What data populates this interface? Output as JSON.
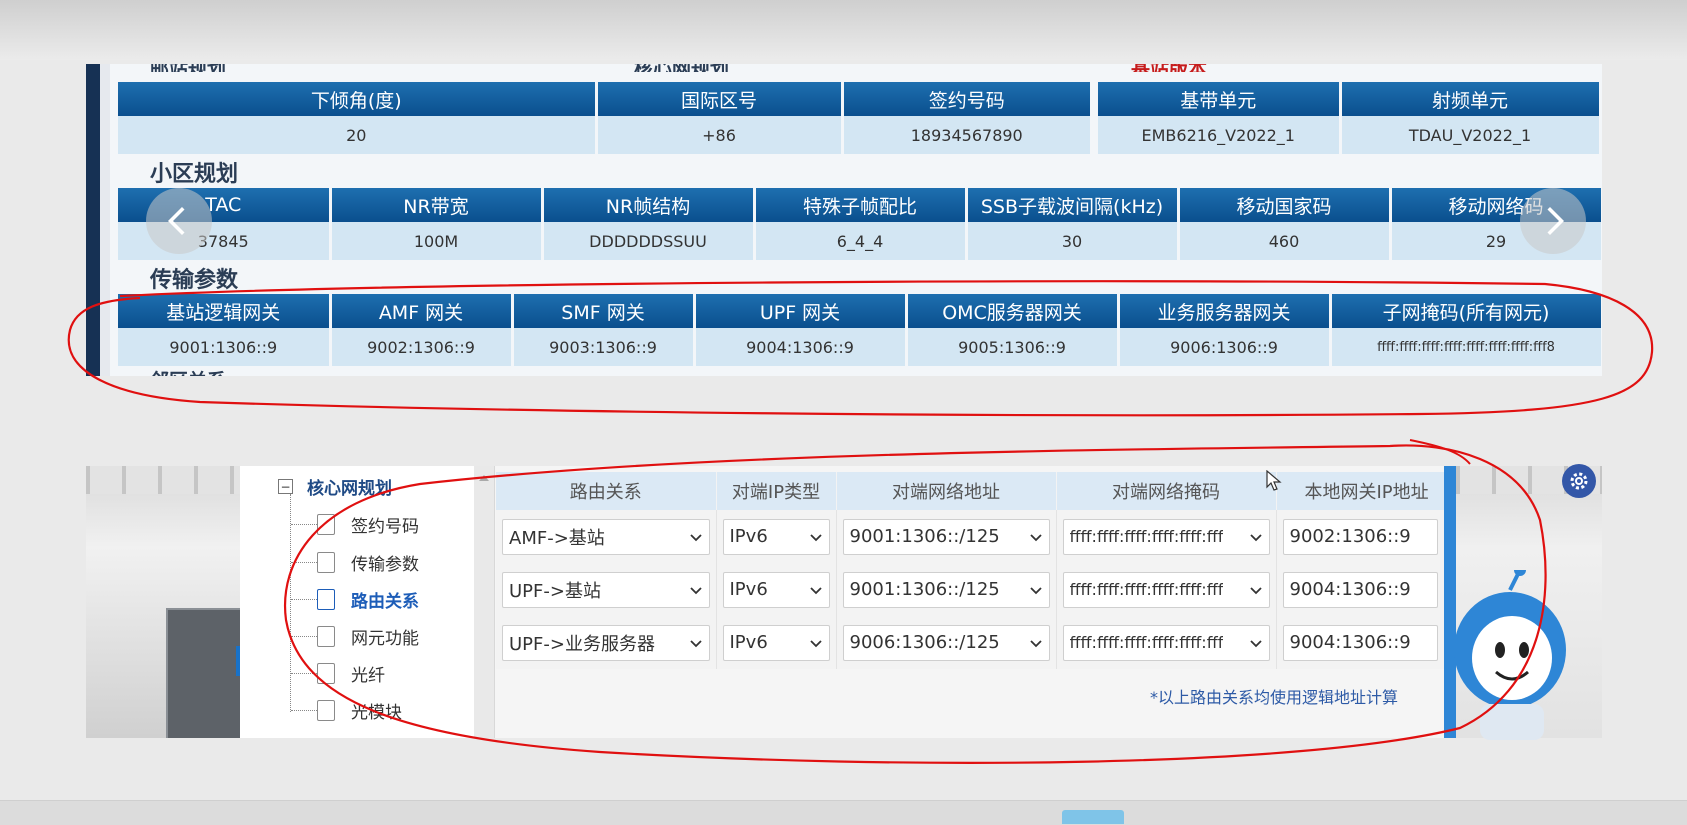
{
  "top": {
    "cut_titles": [
      "邮站规划",
      "核心网规划",
      "基站版本"
    ],
    "row1": {
      "headers": [
        "下倾角(度)",
        "国际区号",
        "签约号码",
        "基带单元",
        "射频单元"
      ],
      "values": [
        "20",
        "+86",
        "18934567890",
        "EMB6216_V2022_1",
        "TDAU_V2022_1"
      ]
    },
    "cell_title": "小区规划",
    "row2": {
      "headers": [
        "TAC",
        "NR带宽",
        "NR帧结构",
        "特殊子帧配比",
        "SSB子载波间隔(kHz)",
        "移动国家码",
        "移动网络码"
      ],
      "values": [
        "37845",
        "100M",
        "DDDDDDSSUU",
        "6_4_4",
        "30",
        "460",
        "29"
      ]
    },
    "trans_title": "传输参数",
    "row3": {
      "headers": [
        "基站逻辑网关",
        "AMF 网关",
        "SMF 网关",
        "UPF 网关",
        "OMC服务器网关",
        "业务服务器网关",
        "子网掩码(所有网元)"
      ],
      "values": [
        "9001:1306::9",
        "9002:1306::9",
        "9003:1306::9",
        "9004:1306::9",
        "9005:1306::9",
        "9006:1306::9",
        "ffff:ffff:ffff:ffff:ffff:ffff:ffff:fff8"
      ]
    },
    "cut_bottom_title": "邻区关系"
  },
  "tree": {
    "root_label": "核心网规划",
    "items": [
      {
        "label": "签约号码",
        "active": false
      },
      {
        "label": "传输参数",
        "active": false
      },
      {
        "label": "路由关系",
        "active": true
      },
      {
        "label": "网元功能",
        "active": false
      },
      {
        "label": "光纤",
        "active": false
      },
      {
        "label": "光模块",
        "active": false
      }
    ]
  },
  "route_table": {
    "headers": [
      "路由关系",
      "对端IP类型",
      "对端网络地址",
      "对端网络掩码",
      "本地网关IP地址"
    ],
    "rows": [
      {
        "relation": "AMF->基站",
        "ip_type": "IPv6",
        "addr": "9001:1306::/125",
        "mask": "ffff:ffff:ffff:ffff:ffff:fff",
        "gw": "9002:1306::9"
      },
      {
        "relation": "UPF->基站",
        "ip_type": "IPv6",
        "addr": "9001:1306::/125",
        "mask": "ffff:ffff:ffff:ffff:ffff:fff",
        "gw": "9004:1306::9"
      },
      {
        "relation": "UPF->业务服务器",
        "ip_type": "IPv6",
        "addr": "9006:1306::/125",
        "mask": "ffff:ffff:ffff:ffff:ffff:fff",
        "gw": "9004:1306::9"
      }
    ],
    "note": "*以上路由关系均使用逻辑地址计算"
  },
  "colors": {
    "header_blue": "#0a4f8e",
    "annotation_red": "#e01010",
    "accent_blue": "#2e86d6"
  }
}
